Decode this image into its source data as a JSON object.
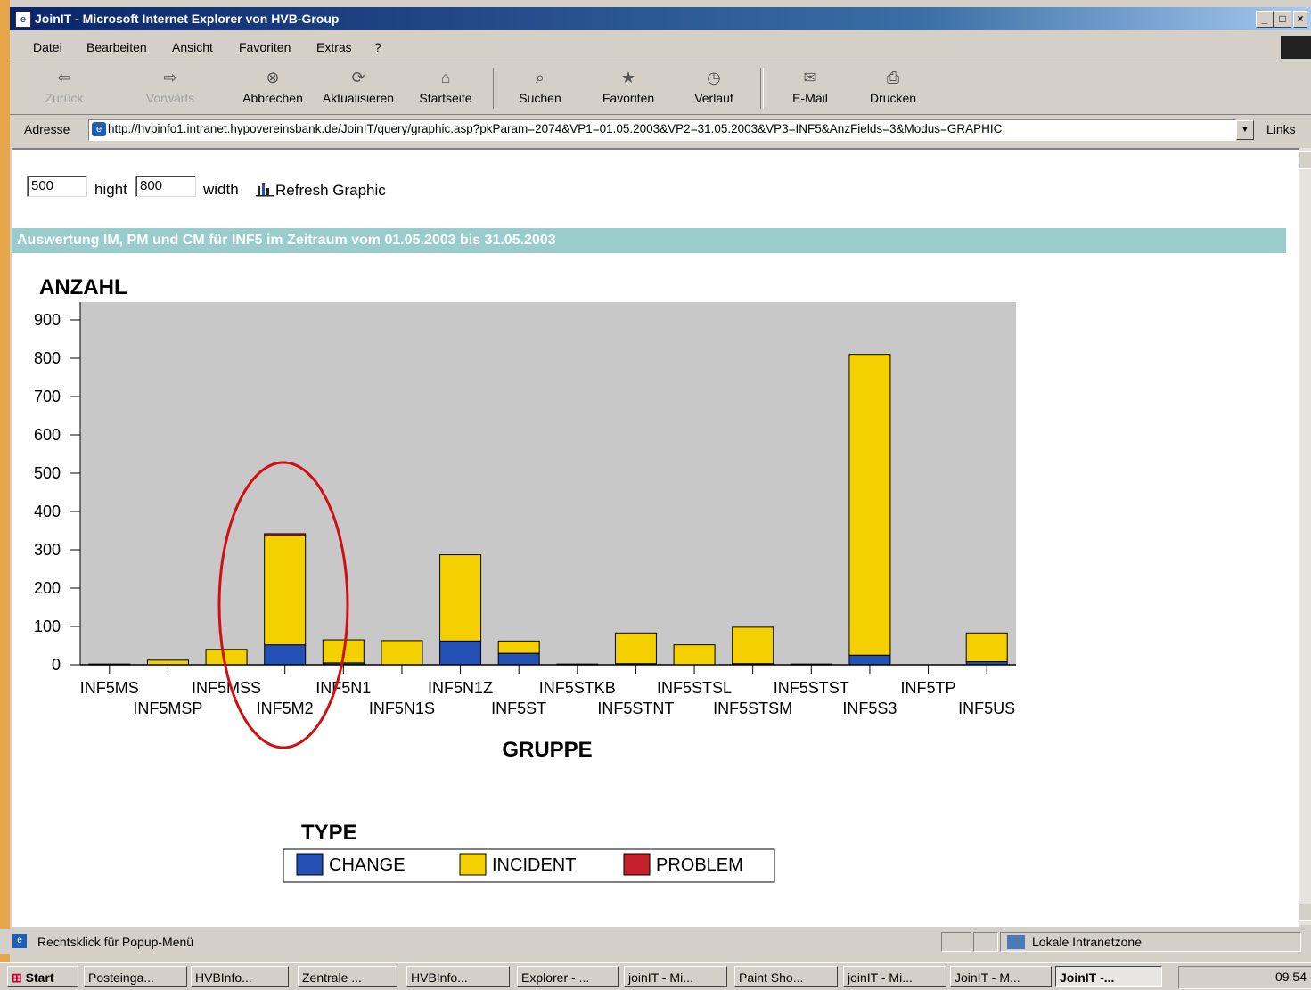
{
  "window": {
    "title": "JoinIT - Microsoft Internet Explorer von HVB-Group",
    "controls": [
      "_",
      "□",
      "×"
    ]
  },
  "menu": [
    "Datei",
    "Bearbeiten",
    "Ansicht",
    "Favoriten",
    "Extras",
    "?"
  ],
  "toolbar": {
    "back": "Zurück",
    "forward": "Vorwärts",
    "stop": "Abbrechen",
    "refresh": "Aktualisieren",
    "home": "Startseite",
    "search": "Suchen",
    "favorites": "Favoriten",
    "history": "Verlauf",
    "mail": "E-Mail",
    "print": "Drucken"
  },
  "address": {
    "label": "Adresse",
    "url": "http://hvbinfo1.intranet.hypovereinsbank.de/JoinIT/query/graphic.asp?pkParam=2074&VP1=01.05.2003&VP2=31.05.2003&VP3=INF5&AnzFields=3&Modus=GRAPHIC",
    "links": "Links"
  },
  "controls": {
    "height_value": "500",
    "height_label": "hight",
    "width_value": "800",
    "width_label": "width",
    "refresh_label": "Refresh Graphic"
  },
  "banner": "Auswertung IM, PM und CM für INF5 im Zeitraum vom 01.05.2003 bis 31.05.2003",
  "chart_data": {
    "type": "bar",
    "stacked": true,
    "ylabel": "ANZAHL",
    "xlabel": "GRUPPE",
    "ylim": [
      0,
      900
    ],
    "yticks": [
      0,
      100,
      200,
      300,
      400,
      500,
      600,
      700,
      800,
      900
    ],
    "categories": [
      "INF5MS",
      "INF5MSP",
      "INF5MSS",
      "INF5M2",
      "INF5N1",
      "INF5N1S",
      "INF5N1Z",
      "INF5ST",
      "INF5STKB",
      "INF5STNT",
      "INF5STSL",
      "INF5STSM",
      "INF5STST",
      "INF5S3",
      "INF5TP",
      "INF5US"
    ],
    "series": [
      {
        "name": "CHANGE",
        "color": "#2350b4",
        "values": [
          0,
          0,
          0,
          52,
          5,
          0,
          62,
          30,
          0,
          3,
          0,
          3,
          0,
          25,
          0,
          8
        ]
      },
      {
        "name": "INCIDENT",
        "color": "#f5d000",
        "values": [
          2,
          12,
          40,
          285,
          60,
          63,
          225,
          32,
          2,
          80,
          52,
          95,
          2,
          785,
          0,
          75
        ]
      },
      {
        "name": "PROBLEM",
        "color": "#c8202a",
        "values": [
          0,
          0,
          0,
          5,
          0,
          0,
          0,
          0,
          0,
          0,
          0,
          0,
          0,
          0,
          0,
          0
        ]
      }
    ],
    "legend_title": "TYPE",
    "legend_position": "bottom",
    "background": "#c8c8c8",
    "highlight": "INF5M2"
  },
  "status": {
    "text": "Rechtsklick für Popup-Menü",
    "zone": "Lokale Intranetzone"
  },
  "taskbar": {
    "start": "Start",
    "tasks": [
      "Posteinga...",
      "HVBInfo...",
      "Zentrale ...",
      "HVBInfo...",
      "Explorer - ...",
      "joinIT - Mi...",
      "Paint Sho...",
      "joinIT - Mi...",
      "JoinIT - M...",
      "JoinIT -..."
    ],
    "clock": "09:54"
  }
}
